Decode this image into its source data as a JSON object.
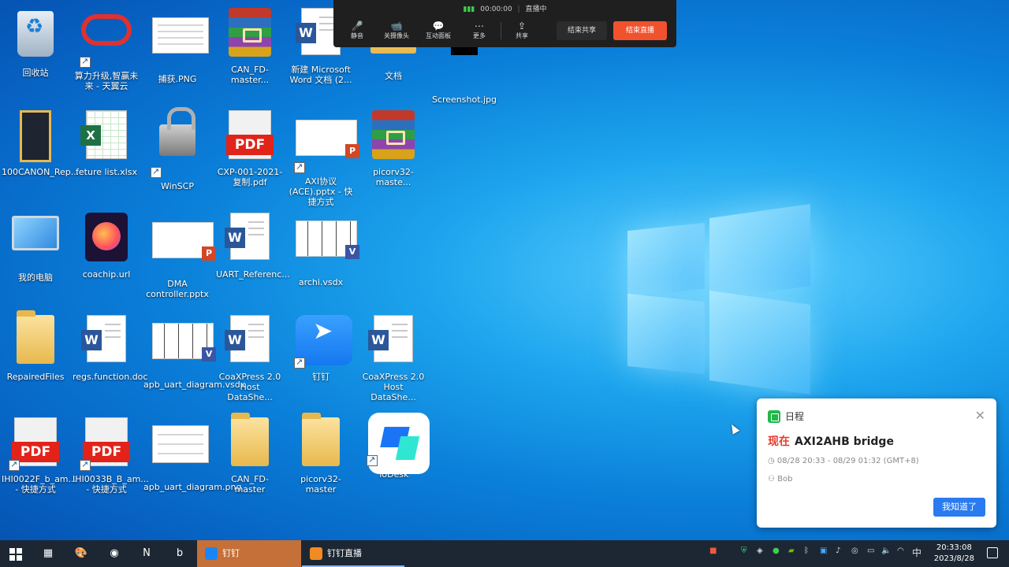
{
  "desktop": {
    "icons": [
      {
        "label": "回收站",
        "icon": "recycle-bin-icon"
      },
      {
        "label": "算力升级,智赢未来 - 天翼云",
        "icon": "cloud-icon"
      },
      {
        "label": "捕获.PNG",
        "icon": "image-icon"
      },
      {
        "label": "CAN_FD-master...",
        "icon": "winrar-icon"
      },
      {
        "label": "新建 Microsoft Word 文档 (2...",
        "icon": "word-doc-icon"
      },
      {
        "label": "文档",
        "icon": "folder-icon"
      },
      {
        "label": "Screenshot.jpg",
        "icon": "image-icon"
      },
      {
        "label": "100CANON_Rep...",
        "icon": "folder-icon"
      },
      {
        "label": "feture list.xlsx",
        "icon": "excel-icon"
      },
      {
        "label": "WinSCP",
        "icon": "winscp-icon"
      },
      {
        "label": "CXP-001-2021-复制.pdf",
        "icon": "pdf-icon"
      },
      {
        "label": "AXI协议(ACE).pptx - 快捷方式",
        "icon": "pptx-icon"
      },
      {
        "label": "picorv32-maste...",
        "icon": "winrar-icon"
      },
      {
        "label": "我的电脑",
        "icon": "computer-icon"
      },
      {
        "label": "coachip.url",
        "icon": "firefox-icon"
      },
      {
        "label": "DMA controller.pptx",
        "icon": "pptx-icon"
      },
      {
        "label": "UART_Referenc...",
        "icon": "word-doc-icon"
      },
      {
        "label": "archi.vsdx",
        "icon": "visio-icon"
      },
      {
        "label": "RepairedFiles",
        "icon": "folder-icon"
      },
      {
        "label": "regs.function.doc",
        "icon": "word-doc-icon"
      },
      {
        "label": "apb_uart_diagram.vsdx",
        "icon": "visio-icon"
      },
      {
        "label": "CoaXPress 2.0 Host DataShe...",
        "icon": "word-doc-icon"
      },
      {
        "label": "钉钉",
        "icon": "dingtalk-icon"
      },
      {
        "label": "CoaXPress 2.0 Host DataShe...",
        "icon": "word-doc-icon"
      },
      {
        "label": "IHI0022F_b_am... - 快捷方式",
        "icon": "pdf-icon"
      },
      {
        "label": "IHI0033B_B_am... - 快捷方式",
        "icon": "pdf-icon"
      },
      {
        "label": "apb_uart_diagram.png",
        "icon": "image-icon"
      },
      {
        "label": "CAN_FD-master",
        "icon": "folder-icon"
      },
      {
        "label": "picorv32-master",
        "icon": "folder-icon"
      },
      {
        "label": "ToDesk",
        "icon": "todesk-icon"
      }
    ]
  },
  "livebar": {
    "timer": "00:00:00",
    "status": "直播中",
    "buttons": [
      {
        "label": "静音",
        "glyph": "🎤"
      },
      {
        "label": "关摄像头",
        "glyph": "📹"
      },
      {
        "label": "互动面板",
        "glyph": "💬"
      },
      {
        "label": "更多",
        "glyph": "⋯"
      },
      {
        "label": "共享",
        "glyph": "⇪"
      }
    ],
    "stop_share": "结束共享",
    "end_live": "结束直播"
  },
  "notice": {
    "app": "日程",
    "now": "现在",
    "title": "AXI2AHB bridge",
    "time": "08/28 20:33 - 08/29 01:32 (GMT+8)",
    "user": "Bob",
    "ok": "我知道了",
    "close": "✕"
  },
  "taskbar": {
    "apps": [
      {
        "label": "钉钉",
        "active": true
      },
      {
        "label": "钉钉直播",
        "active": false
      }
    ],
    "ime": "中",
    "time": "20:33:08",
    "date": "2023/8/28"
  }
}
